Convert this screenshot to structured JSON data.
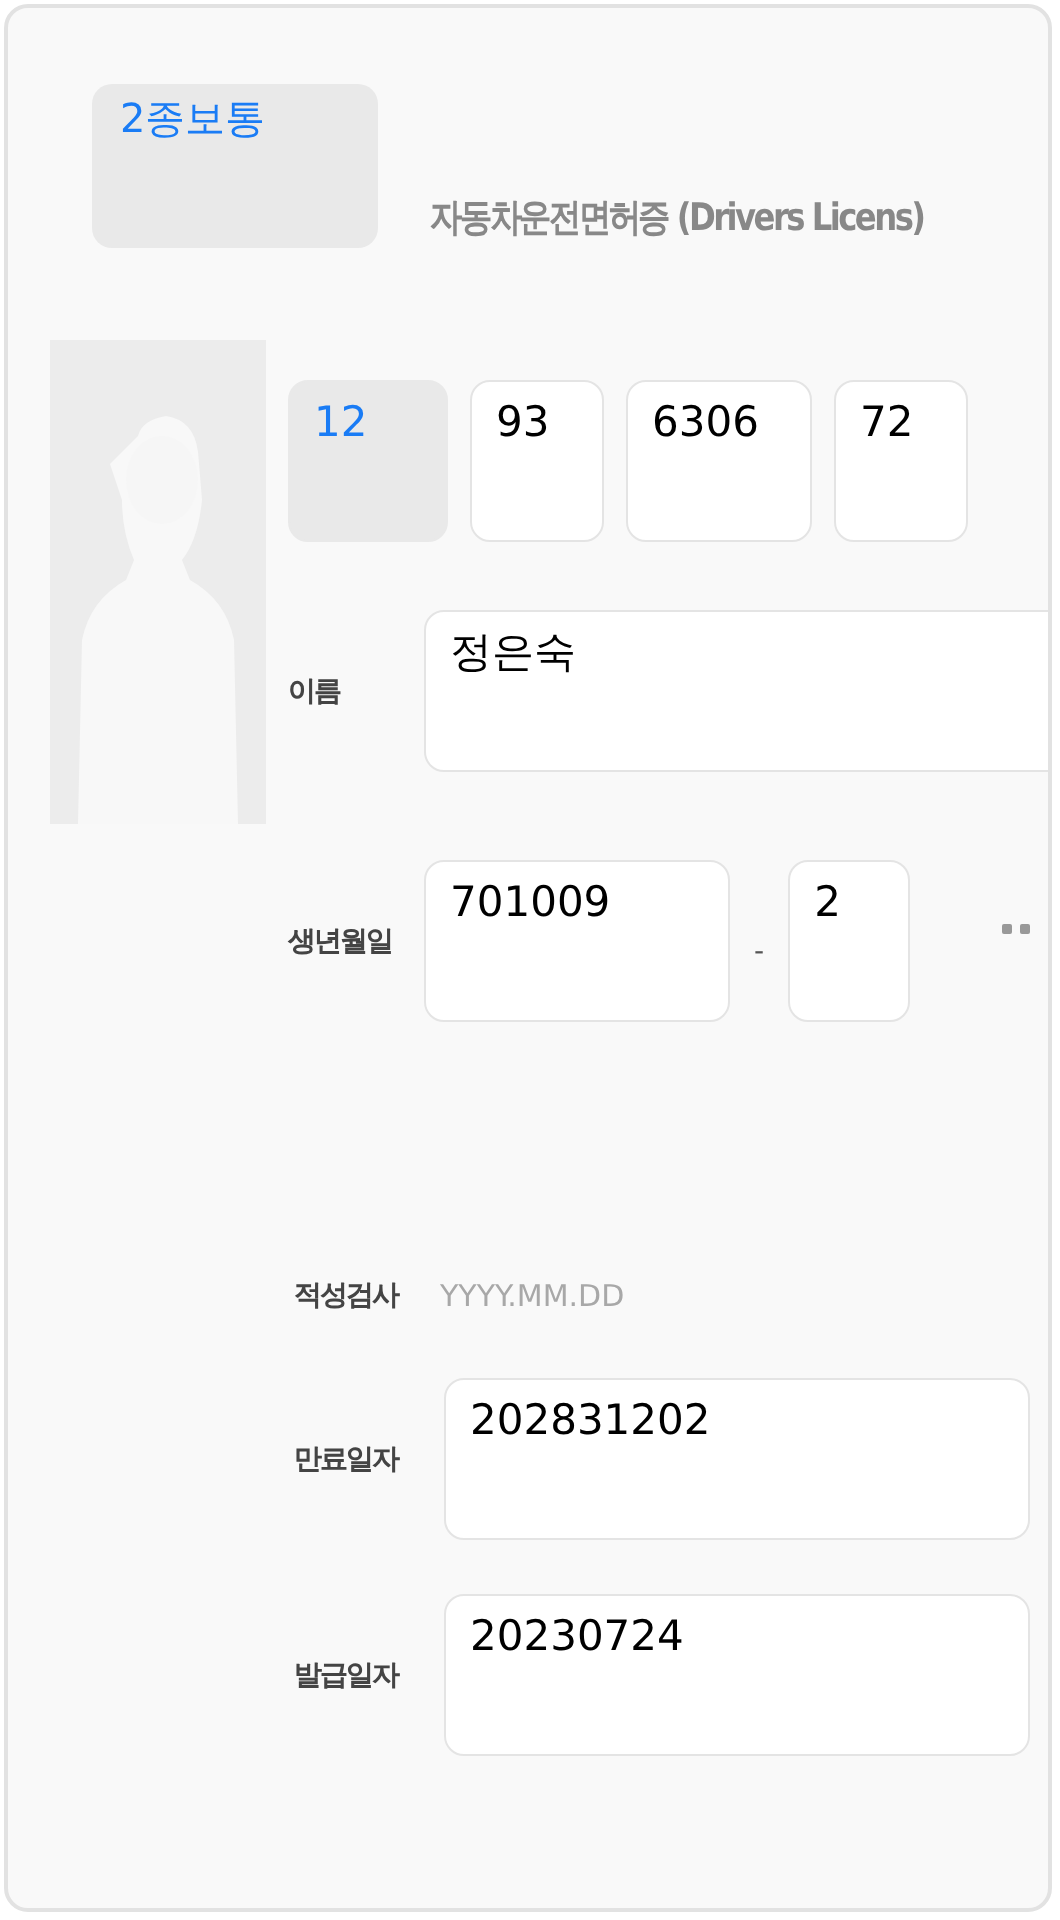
{
  "license_class": "2종보통",
  "title": "자동차운전면허증 (Drivers Licens)",
  "license_number": [
    {
      "value": "12",
      "kind": "region"
    },
    {
      "value": "93"
    },
    {
      "value": "6306"
    },
    {
      "value": "72"
    }
  ],
  "name": {
    "label": "이름",
    "value": "정은숙"
  },
  "birth": {
    "label": "생년월일",
    "value": "701009",
    "separator": "-",
    "gender_value": "2"
  },
  "aptitude_test": {
    "label": "적성검사",
    "placeholder": "YYYY.MM.DD"
  },
  "expiry": {
    "label": "만료일자",
    "value": "202831202"
  },
  "issue": {
    "label": "발급일자",
    "value": "20230724"
  }
}
